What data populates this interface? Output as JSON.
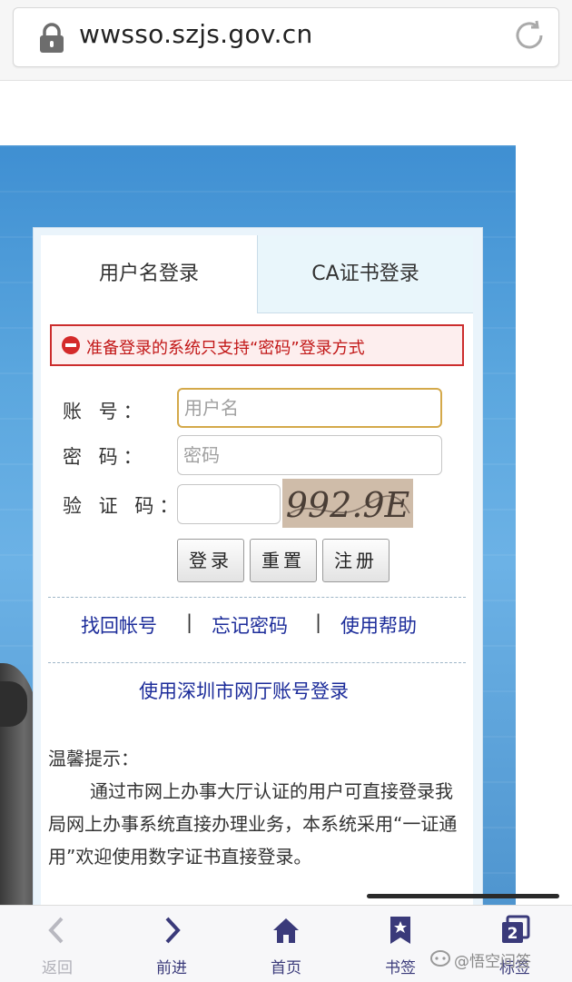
{
  "browser": {
    "url": "wwsso.szjs.gov.cn"
  },
  "login": {
    "tabs": [
      "用户名登录",
      "CA证书登录"
    ],
    "alert": "准备登录的系统只支持“密码”登录方式",
    "labels": {
      "account": "账 号：",
      "password": "密 码：",
      "captcha": "验 证 码："
    },
    "placeholders": {
      "account": "用户名",
      "password": "密码"
    },
    "captcha_image_text": "992.9E",
    "buttons": {
      "login": "登录",
      "reset": "重置",
      "register": "注册"
    },
    "links": {
      "recover_account": "找回帐号",
      "forgot_password": "忘记密码",
      "help": "使用帮助",
      "separator": "|",
      "shenzhen_login": "使用深圳市网厅账号登录"
    },
    "tips_title": "温馨提示：",
    "tips_body": "通过市网上办事大厅认证的用户可直接登录我局网上办事系统直接办理业务，本系统采用“一证通用”欢迎使用数字证书直接登录。"
  },
  "toolbar": {
    "back": "返回",
    "forward": "前进",
    "home": "首页",
    "bookmarks": "书签",
    "tabs": "标签",
    "tab_count": "2"
  },
  "watermark": "@悟空问答",
  "colors": {
    "page_blue": "#4f9bd8",
    "alert_red": "#cc2d2d",
    "link_blue": "#1c2c9a",
    "toolbar_icon": "#3a3a7a"
  }
}
